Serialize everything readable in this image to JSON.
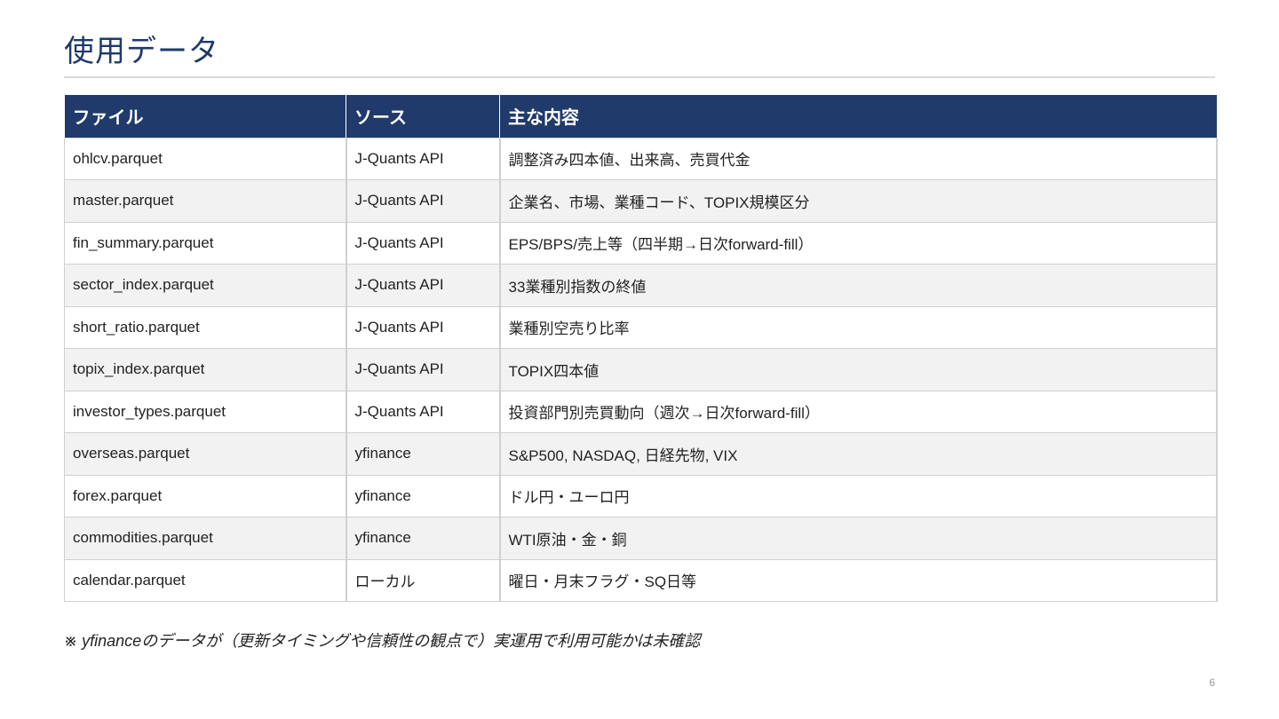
{
  "title": "使用データ",
  "table": {
    "headers": [
      "ファイル",
      "ソース",
      "主な内容"
    ],
    "rows": [
      {
        "file": "ohlcv.parquet",
        "source": "J-Quants API",
        "content": "調整済み四本値、出来高、売買代金"
      },
      {
        "file": "master.parquet",
        "source": "J-Quants API",
        "content": "企業名、市場、業種コード、TOPIX規模区分"
      },
      {
        "file": "fin_summary.parquet",
        "source": "J-Quants API",
        "content": "EPS/BPS/売上等（四半期→日次forward-fill）"
      },
      {
        "file": "sector_index.parquet",
        "source": "J-Quants API",
        "content": "33業種別指数の終値"
      },
      {
        "file": "short_ratio.parquet",
        "source": "J-Quants API",
        "content": "業種別空売り比率"
      },
      {
        "file": "topix_index.parquet",
        "source": "J-Quants API",
        "content": "TOPIX四本値"
      },
      {
        "file": "investor_types.parquet",
        "source": "J-Quants API",
        "content": "投資部門別売買動向（週次→日次forward-fill）"
      },
      {
        "file": "overseas.parquet",
        "source": "yfinance",
        "content": "S&P500, NASDAQ, 日経先物, VIX"
      },
      {
        "file": "forex.parquet",
        "source": "yfinance",
        "content": "ドル円・ユーロ円"
      },
      {
        "file": "commodities.parquet",
        "source": "yfinance",
        "content": "WTI原油・金・銅"
      },
      {
        "file": "calendar.parquet",
        "source": "ローカル",
        "content": "曜日・月末フラグ・SQ日等"
      }
    ]
  },
  "footnote": "※ yfinanceのデータが（更新タイミングや信頼性の観点で）実運用で利用可能かは未確認",
  "page_number": "6",
  "colors": {
    "accent": "#1f3a6b",
    "header_text": "#ffffff",
    "row_alt": "#f2f2f2",
    "border": "#d0d0d0"
  }
}
